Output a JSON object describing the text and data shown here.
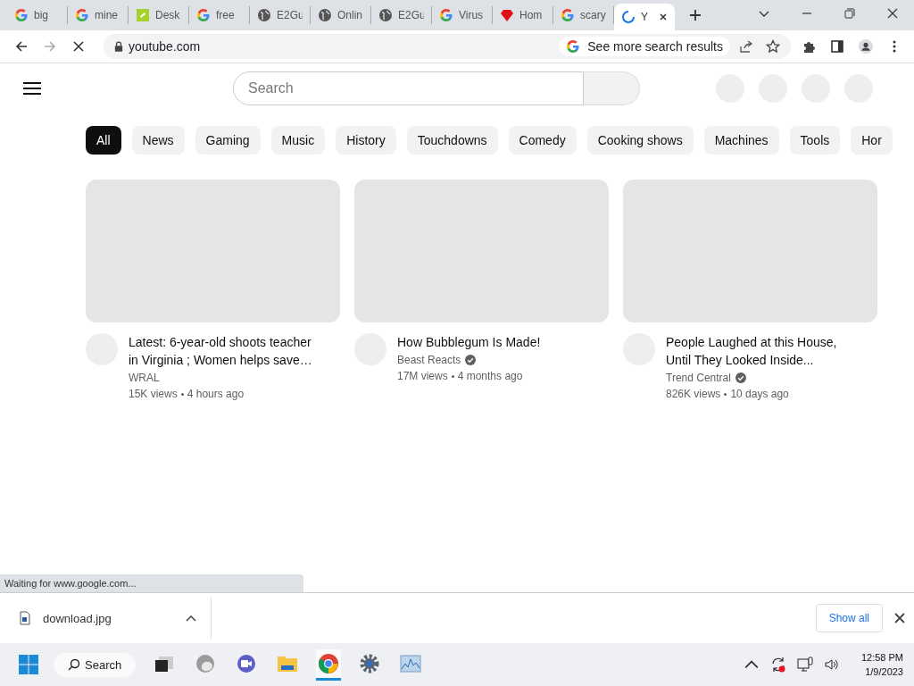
{
  "tabs": [
    {
      "title": "big",
      "kind": "google",
      "selected": false
    },
    {
      "title": "mine",
      "kind": "google",
      "selected": false
    },
    {
      "title": "Desk",
      "kind": "desk",
      "selected": false
    },
    {
      "title": "free",
      "kind": "google",
      "selected": false
    },
    {
      "title": "E2Gu",
      "kind": "globe",
      "selected": false
    },
    {
      "title": "Onlin",
      "kind": "globe",
      "selected": false
    },
    {
      "title": "E2Gu",
      "kind": "globe",
      "selected": false
    },
    {
      "title": "Virus",
      "kind": "google",
      "selected": false
    },
    {
      "title": "Hom",
      "kind": "gem",
      "selected": false
    },
    {
      "title": "scary",
      "kind": "google",
      "selected": false
    },
    {
      "title": "Y",
      "kind": "loading",
      "selected": true
    }
  ],
  "address_bar": {
    "url": "youtube.com",
    "suggestion": "See more search results"
  },
  "youtube": {
    "search": {
      "placeholder": "Search"
    },
    "chips": [
      {
        "label": "All",
        "selected": true
      },
      {
        "label": "News",
        "selected": false
      },
      {
        "label": "Gaming",
        "selected": false
      },
      {
        "label": "Music",
        "selected": false
      },
      {
        "label": "History",
        "selected": false
      },
      {
        "label": "Touchdowns",
        "selected": false
      },
      {
        "label": "Comedy",
        "selected": false
      },
      {
        "label": "Cooking shows",
        "selected": false
      },
      {
        "label": "Machines",
        "selected": false
      },
      {
        "label": "Tools",
        "selected": false
      },
      {
        "label": "Hor",
        "selected": false
      }
    ],
    "videos": [
      {
        "title": "Latest: 6-year-old shoots teacher in Virginia ; Women helps save…",
        "channel": "WRAL",
        "verified": false,
        "views": "15K views",
        "age": "4 hours ago"
      },
      {
        "title": "How Bubblegum Is Made!",
        "channel": "Beast Reacts",
        "verified": true,
        "views": "17M views",
        "age": "4 months ago"
      },
      {
        "title": "People Laughed at this House, Until They Looked Inside...",
        "channel": "Trend Central",
        "verified": true,
        "views": "826K views",
        "age": "10 days ago"
      }
    ]
  },
  "status_bubble": "Waiting for www.google.com...",
  "download_bar": {
    "file": "download.jpg",
    "show_all": "Show all"
  },
  "taskbar": {
    "search": "Search",
    "apps": [
      {
        "kind": "taskview",
        "active": false
      },
      {
        "kind": "edge",
        "active": false
      },
      {
        "kind": "meet",
        "active": false
      },
      {
        "kind": "folder",
        "active": false
      },
      {
        "kind": "chrome",
        "active": true
      },
      {
        "kind": "settings",
        "active": false
      },
      {
        "kind": "photos",
        "active": false
      }
    ],
    "time": "12:58 PM",
    "date": "1/9/2023"
  }
}
